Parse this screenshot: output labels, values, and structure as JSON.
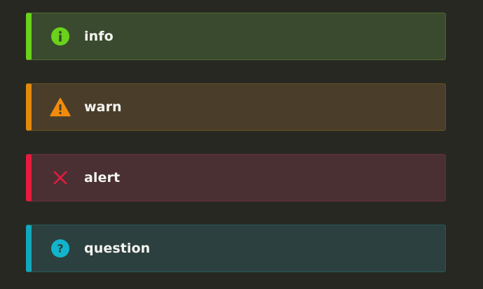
{
  "callouts": [
    {
      "kind": "info",
      "label": "info",
      "icon": "info-circle-icon",
      "accent": "#6ad21a"
    },
    {
      "kind": "warn",
      "label": "warn",
      "icon": "warning-triangle-icon",
      "accent": "#f08c0c"
    },
    {
      "kind": "alert",
      "label": "alert",
      "icon": "close-x-icon",
      "accent": "#e81a3e"
    },
    {
      "kind": "question",
      "label": "question",
      "icon": "question-circle-icon",
      "accent": "#12b4cc"
    }
  ]
}
